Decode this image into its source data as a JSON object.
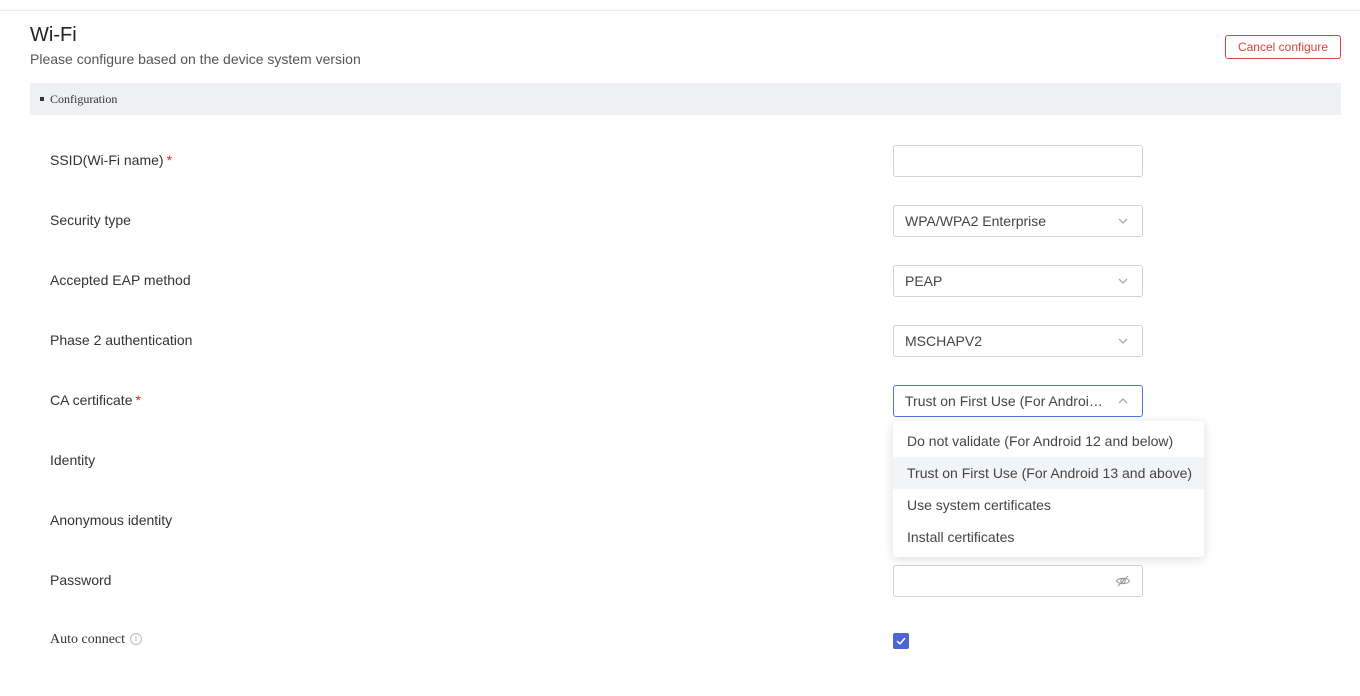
{
  "header": {
    "title": "Wi-Fi",
    "subtitle": "Please configure based on the device system version",
    "cancel_label": "Cancel configure"
  },
  "section": {
    "label": "Configuration"
  },
  "fields": {
    "ssid": {
      "label": "SSID(Wi-Fi name)",
      "required_mark": "*",
      "value": ""
    },
    "security_type": {
      "label": "Security type",
      "value": "WPA/WPA2 Enterprise"
    },
    "eap_method": {
      "label": "Accepted EAP method",
      "value": "PEAP"
    },
    "phase2": {
      "label": "Phase 2 authentication",
      "value": "MSCHAPV2"
    },
    "ca_certificate": {
      "label": "CA certificate",
      "required_mark": "*",
      "value": "Trust on First Use (For Android 13 and above)",
      "options": [
        "Do not validate (For Android 12 and below)",
        "Trust on First Use (For Android 13 and above)",
        "Use system certificates",
        "Install certificates"
      ],
      "selected_index": 1
    },
    "identity": {
      "label": "Identity"
    },
    "anonymous_identity": {
      "label": "Anonymous identity"
    },
    "password": {
      "label": "Password",
      "value": ""
    },
    "auto_connect": {
      "label": "Auto connect",
      "checked": true
    }
  },
  "icons": {
    "chevron_down": "chevron-down-icon",
    "chevron_up": "chevron-up-icon",
    "eye_off": "eye-off-icon",
    "info": "info-icon",
    "check": "check-icon"
  },
  "colors": {
    "accent": "#4c66d4",
    "danger": "#e0403a",
    "section_bg": "#eef0f3"
  }
}
